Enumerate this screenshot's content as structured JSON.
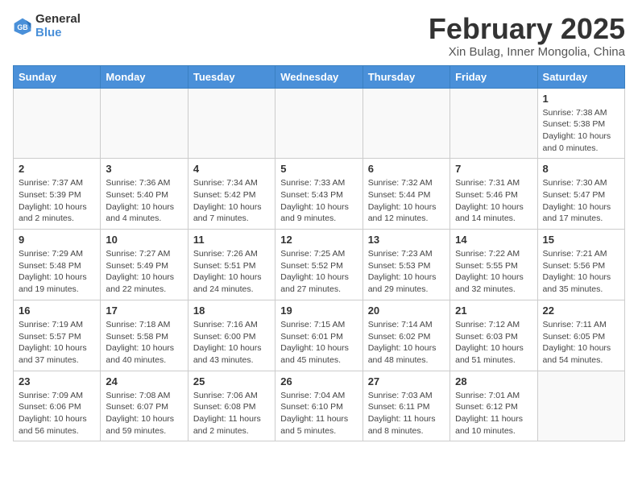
{
  "header": {
    "logo_line1": "General",
    "logo_line2": "Blue",
    "month_year": "February 2025",
    "location": "Xin Bulag, Inner Mongolia, China"
  },
  "weekdays": [
    "Sunday",
    "Monday",
    "Tuesday",
    "Wednesday",
    "Thursday",
    "Friday",
    "Saturday"
  ],
  "weeks": [
    [
      {
        "day": "",
        "info": ""
      },
      {
        "day": "",
        "info": ""
      },
      {
        "day": "",
        "info": ""
      },
      {
        "day": "",
        "info": ""
      },
      {
        "day": "",
        "info": ""
      },
      {
        "day": "",
        "info": ""
      },
      {
        "day": "1",
        "info": "Sunrise: 7:38 AM\nSunset: 5:38 PM\nDaylight: 10 hours\nand 0 minutes."
      }
    ],
    [
      {
        "day": "2",
        "info": "Sunrise: 7:37 AM\nSunset: 5:39 PM\nDaylight: 10 hours\nand 2 minutes."
      },
      {
        "day": "3",
        "info": "Sunrise: 7:36 AM\nSunset: 5:40 PM\nDaylight: 10 hours\nand 4 minutes."
      },
      {
        "day": "4",
        "info": "Sunrise: 7:34 AM\nSunset: 5:42 PM\nDaylight: 10 hours\nand 7 minutes."
      },
      {
        "day": "5",
        "info": "Sunrise: 7:33 AM\nSunset: 5:43 PM\nDaylight: 10 hours\nand 9 minutes."
      },
      {
        "day": "6",
        "info": "Sunrise: 7:32 AM\nSunset: 5:44 PM\nDaylight: 10 hours\nand 12 minutes."
      },
      {
        "day": "7",
        "info": "Sunrise: 7:31 AM\nSunset: 5:46 PM\nDaylight: 10 hours\nand 14 minutes."
      },
      {
        "day": "8",
        "info": "Sunrise: 7:30 AM\nSunset: 5:47 PM\nDaylight: 10 hours\nand 17 minutes."
      }
    ],
    [
      {
        "day": "9",
        "info": "Sunrise: 7:29 AM\nSunset: 5:48 PM\nDaylight: 10 hours\nand 19 minutes."
      },
      {
        "day": "10",
        "info": "Sunrise: 7:27 AM\nSunset: 5:49 PM\nDaylight: 10 hours\nand 22 minutes."
      },
      {
        "day": "11",
        "info": "Sunrise: 7:26 AM\nSunset: 5:51 PM\nDaylight: 10 hours\nand 24 minutes."
      },
      {
        "day": "12",
        "info": "Sunrise: 7:25 AM\nSunset: 5:52 PM\nDaylight: 10 hours\nand 27 minutes."
      },
      {
        "day": "13",
        "info": "Sunrise: 7:23 AM\nSunset: 5:53 PM\nDaylight: 10 hours\nand 29 minutes."
      },
      {
        "day": "14",
        "info": "Sunrise: 7:22 AM\nSunset: 5:55 PM\nDaylight: 10 hours\nand 32 minutes."
      },
      {
        "day": "15",
        "info": "Sunrise: 7:21 AM\nSunset: 5:56 PM\nDaylight: 10 hours\nand 35 minutes."
      }
    ],
    [
      {
        "day": "16",
        "info": "Sunrise: 7:19 AM\nSunset: 5:57 PM\nDaylight: 10 hours\nand 37 minutes."
      },
      {
        "day": "17",
        "info": "Sunrise: 7:18 AM\nSunset: 5:58 PM\nDaylight: 10 hours\nand 40 minutes."
      },
      {
        "day": "18",
        "info": "Sunrise: 7:16 AM\nSunset: 6:00 PM\nDaylight: 10 hours\nand 43 minutes."
      },
      {
        "day": "19",
        "info": "Sunrise: 7:15 AM\nSunset: 6:01 PM\nDaylight: 10 hours\nand 45 minutes."
      },
      {
        "day": "20",
        "info": "Sunrise: 7:14 AM\nSunset: 6:02 PM\nDaylight: 10 hours\nand 48 minutes."
      },
      {
        "day": "21",
        "info": "Sunrise: 7:12 AM\nSunset: 6:03 PM\nDaylight: 10 hours\nand 51 minutes."
      },
      {
        "day": "22",
        "info": "Sunrise: 7:11 AM\nSunset: 6:05 PM\nDaylight: 10 hours\nand 54 minutes."
      }
    ],
    [
      {
        "day": "23",
        "info": "Sunrise: 7:09 AM\nSunset: 6:06 PM\nDaylight: 10 hours\nand 56 minutes."
      },
      {
        "day": "24",
        "info": "Sunrise: 7:08 AM\nSunset: 6:07 PM\nDaylight: 10 hours\nand 59 minutes."
      },
      {
        "day": "25",
        "info": "Sunrise: 7:06 AM\nSunset: 6:08 PM\nDaylight: 11 hours\nand 2 minutes."
      },
      {
        "day": "26",
        "info": "Sunrise: 7:04 AM\nSunset: 6:10 PM\nDaylight: 11 hours\nand 5 minutes."
      },
      {
        "day": "27",
        "info": "Sunrise: 7:03 AM\nSunset: 6:11 PM\nDaylight: 11 hours\nand 8 minutes."
      },
      {
        "day": "28",
        "info": "Sunrise: 7:01 AM\nSunset: 6:12 PM\nDaylight: 11 hours\nand 10 minutes."
      },
      {
        "day": "",
        "info": ""
      }
    ]
  ]
}
